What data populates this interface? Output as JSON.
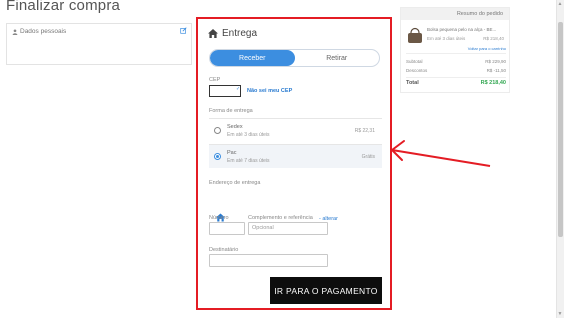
{
  "page": {
    "title": "Finalizar compra"
  },
  "dados_pessoais": {
    "label": "Dados pessoais"
  },
  "entrega": {
    "title": "Entrega",
    "tabs": [
      {
        "label": "Receber",
        "active": true
      },
      {
        "label": "Retirar",
        "active": false
      }
    ],
    "cep": {
      "label": "CEP",
      "value": "",
      "link": "Não sei meu CEP"
    },
    "forma_label": "Forma de entrega",
    "options": [
      {
        "name": "Sedex",
        "time": "Em até 3 dias úteis",
        "price": "R$ 22,31",
        "selected": false
      },
      {
        "name": "Pac",
        "time": "Em até 7 dias úteis",
        "price": "Grátis",
        "selected": true
      }
    ],
    "endereco_label": "Endereço de entrega",
    "alterar_link": "- alterar",
    "numero_label": "Número",
    "complemento_label": "Complemento e referência",
    "complemento_placeholder": "Opcional",
    "destinatario_label": "Destinatário",
    "pay_button": "IR PARA O PAGAMENTO"
  },
  "resumo": {
    "title": "Resumo do pedido",
    "product": {
      "name": "Bolsa pequena pelo na alça - BE...",
      "time": "Em até 3 dias úteis",
      "price": "R$ 218,40"
    },
    "link": "Voltar para o carrinho",
    "subtotal_label": "Subtotal",
    "subtotal_value": "R$ 229,90",
    "descontos_label": "Descontos",
    "descontos_value": "R$ -11,50",
    "total_label": "Total",
    "total_value": "R$ 218,40"
  },
  "colors": {
    "accent": "#3c8ee0",
    "highlight": "#e41c24",
    "button": "#0d0d0d",
    "total": "#34a853"
  }
}
